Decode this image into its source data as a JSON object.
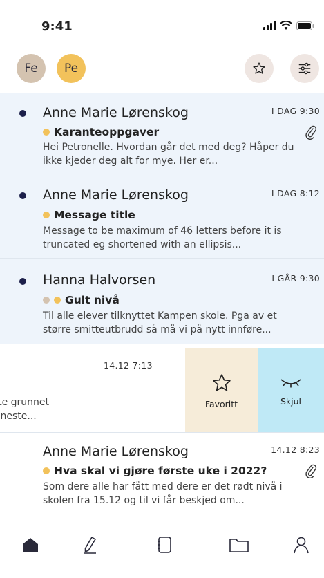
{
  "status": {
    "time": "9:41"
  },
  "header": {
    "avatars": [
      {
        "initials": "Fe",
        "color": "#d4c3b0"
      },
      {
        "initials": "Pe",
        "color": "#f2c25b"
      }
    ],
    "icons": [
      "star-icon",
      "filter-icon"
    ]
  },
  "messages": [
    {
      "sender": "Anne Marie Lørenskog",
      "time": "I DAG 9:30",
      "subject": "Karanteoppgaver",
      "tag_colors": [
        "#f2c25b"
      ],
      "preview": "Hei Petronelle. Hvordan går det med deg? Håper du ikke kjeder deg alt for mye. Her er...",
      "unread": true,
      "attachment": true
    },
    {
      "sender": "Anne Marie Lørenskog",
      "time": "I DAG 8:12",
      "subject": "Message title",
      "tag_colors": [
        "#f2c25b"
      ],
      "preview": "Message to be maximum of 46 letters before it is truncated eg shortened with an ellipsis...",
      "unread": true,
      "attachment": false
    },
    {
      "sender": "Hanna Halvorsen",
      "time": "I GÅR 9:30",
      "subject": "Gult nivå",
      "tag_colors": [
        "#d4c3b0",
        "#f2c25b"
      ],
      "preview": "Til alle elever tilknyttet Kampen skole. Pga av et større smitteutbrudd så må vi på nytt innføre...",
      "unread": true,
      "attachment": false
    }
  ],
  "swiped": {
    "time": "14.12 7:13",
    "preview_line1": "psiale Fau-møte grunnet",
    "preview_line2": "erkere tilbake neste...",
    "actions": {
      "favorite": "Favoritt",
      "hide": "Skjul"
    },
    "favorite_color": "#f6ecd9",
    "hide_color": "#bfe9f6"
  },
  "last_message": {
    "sender": "Anne Marie Lørenskog",
    "time": "14.12 8:23",
    "subject": "Hva skal vi gjøre første uke i 2022?",
    "tag_colors": [
      "#f2c25b"
    ],
    "preview": "Som dere alle har fått med dere er det rødt nivå i skolen fra 15.12 og til vi får beskjed om...",
    "attachment": true
  },
  "tabbar": {
    "items": [
      "home-icon",
      "compose-icon",
      "notebook-icon",
      "folder-icon",
      "profile-icon"
    ]
  },
  "colors": {
    "unread_bg": "#eef4fb",
    "unread_dot": "#1c1f4a",
    "accent_yellow": "#f2c25b"
  }
}
